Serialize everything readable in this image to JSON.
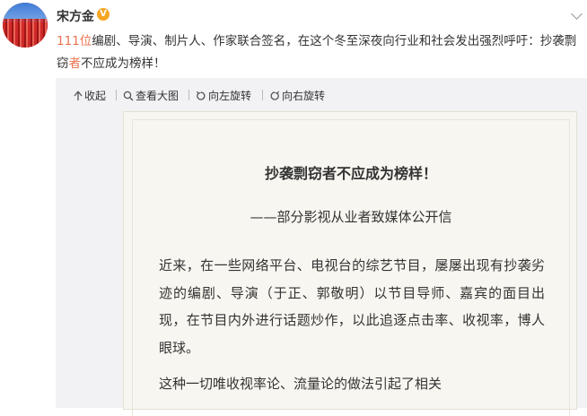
{
  "post": {
    "username": "宋方金",
    "verified_badge": "V",
    "text_highlight": "111位",
    "text_part1": "编剧、导演、制片人、作家联合签名，在这个冬至深夜向行业和社会发出强烈呼吁：抄袭剽窃",
    "text_highlight2": "者",
    "text_part2": "不应成为榜样！"
  },
  "toolbar": {
    "collapse": "收起",
    "view_large": "查看大图",
    "rotate_left": "向左旋转",
    "rotate_right": "向右旋转"
  },
  "letter": {
    "title": "抄袭剽窃者不应成为榜样！",
    "subtitle": "——部分影视从业者致媒体公开信",
    "para1": "近来，在一些网络平台、电视台的综艺节目，屡屡出现有抄袭劣迹的编剧、导演（于正、郭敬明）以节目导师、嘉宾的面目出现，在节目内外进行话题炒作，以此追逐点击率、收视率，博人眼球。",
    "para2": "这种一切唯收视率论、流量论的做法引起了相关"
  },
  "colors": {
    "highlight": "#eb7350",
    "badge": "#f5a623",
    "card_bg": "#f2f2f5",
    "paper_bg": "#f8f6f0"
  }
}
